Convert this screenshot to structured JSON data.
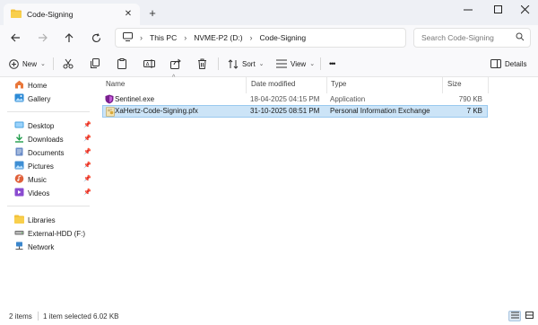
{
  "tab": {
    "title": "Code-Signing"
  },
  "breadcrumb": [
    "This PC",
    "NVME-P2 (D:)",
    "Code-Signing"
  ],
  "search": {
    "placeholder": "Search Code-Signing"
  },
  "commands": {
    "new_label": "New",
    "sort_label": "Sort",
    "view_label": "View",
    "more_label": "•••",
    "details_label": "Details"
  },
  "sidebar": {
    "top": [
      {
        "label": "Home",
        "icon": "home-icon"
      },
      {
        "label": "Gallery",
        "icon": "gallery-icon"
      }
    ],
    "pinned": [
      {
        "label": "Desktop",
        "icon": "desktop-folder-icon"
      },
      {
        "label": "Downloads",
        "icon": "downloads-folder-icon"
      },
      {
        "label": "Documents",
        "icon": "documents-folder-icon"
      },
      {
        "label": "Pictures",
        "icon": "pictures-folder-icon"
      },
      {
        "label": "Music",
        "icon": "music-folder-icon"
      },
      {
        "label": "Videos",
        "icon": "videos-folder-icon"
      }
    ],
    "bottom": [
      {
        "label": "Libraries",
        "icon": "libraries-icon"
      },
      {
        "label": "External-HDD (F:)",
        "icon": "drive-icon"
      },
      {
        "label": "Network",
        "icon": "network-icon"
      }
    ]
  },
  "columns": {
    "name": "Name",
    "date": "Date modified",
    "type": "Type",
    "size": "Size"
  },
  "files": [
    {
      "name": "Sentinel.exe",
      "date": "18-04-2025 04:15 PM",
      "type": "Application",
      "size": "790 KB",
      "icon": "exe-shield-icon",
      "selected": false
    },
    {
      "name": "XaHertz-Code-Signing.pfx",
      "date": "31-10-2025 08:51 PM",
      "type": "Personal Information Exchange",
      "size": "7 KB",
      "icon": "certificate-file-icon",
      "selected": true
    }
  ],
  "status": {
    "items": "2 items",
    "selected": "1 item selected  6.02 KB"
  },
  "colors": {
    "accent": "#0067c0",
    "selection": "#cce4f7",
    "folder": "#f3c23b"
  }
}
